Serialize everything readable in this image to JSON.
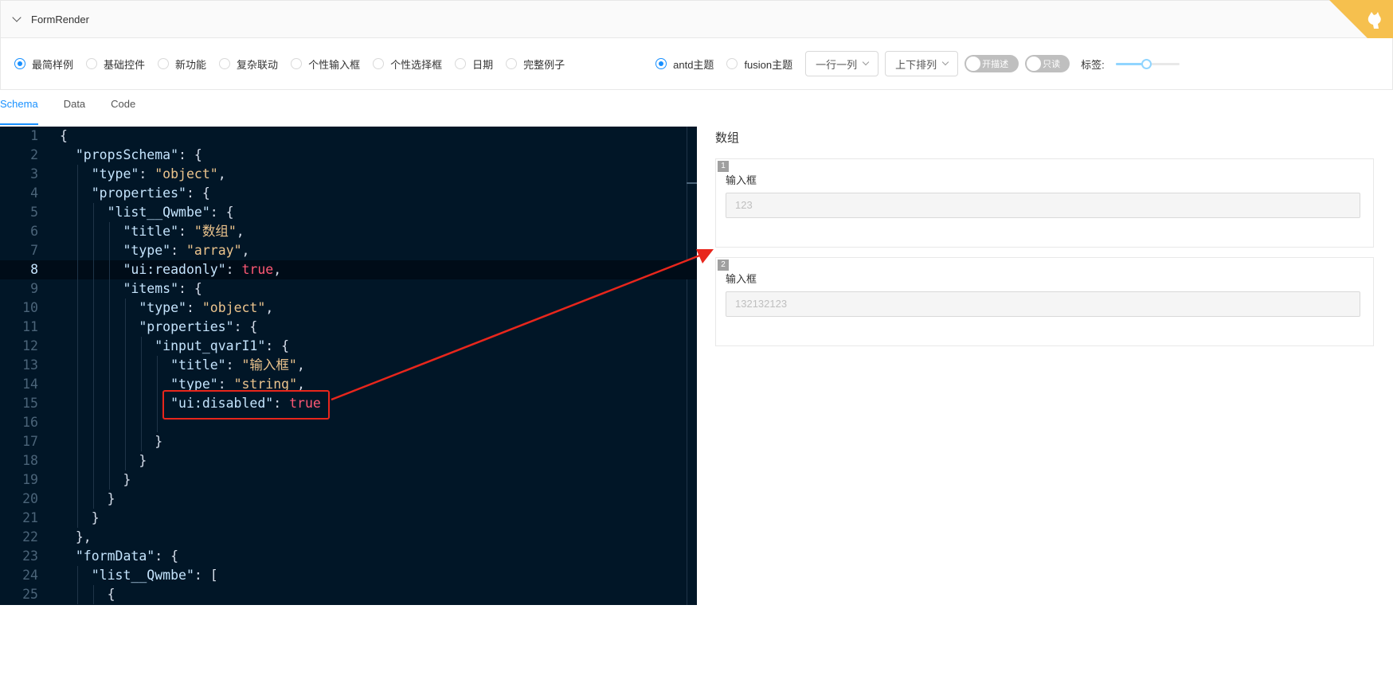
{
  "header": {
    "title": "FormRender"
  },
  "toolbar": {
    "demo_options": [
      {
        "label": "最简样例",
        "checked": true
      },
      {
        "label": "基础控件",
        "checked": false
      },
      {
        "label": "新功能",
        "checked": false
      },
      {
        "label": "复杂联动",
        "checked": false
      },
      {
        "label": "个性输入框",
        "checked": false
      },
      {
        "label": "个性选择框",
        "checked": false
      },
      {
        "label": "日期",
        "checked": false
      },
      {
        "label": "完整例子",
        "checked": false
      }
    ],
    "theme_options": [
      {
        "label": "antd主题",
        "checked": true
      },
      {
        "label": "fusion主题",
        "checked": false
      }
    ],
    "column_select": "一行一列",
    "layout_select": "上下排列",
    "desc_switch": "开描述",
    "readonly_switch": "只读",
    "label_text": "标签:",
    "label_slider_value": 0.48
  },
  "tabs": [
    {
      "label": "Schema",
      "active": true
    },
    {
      "label": "Data",
      "active": false
    },
    {
      "label": "Code",
      "active": false
    }
  ],
  "editor": {
    "current_line": 8,
    "lines": [
      [
        {
          "t": "p",
          "v": "{"
        }
      ],
      [
        {
          "t": "p",
          "v": "  "
        },
        {
          "t": "k",
          "v": "\"propsSchema\""
        },
        {
          "t": "p",
          "v": ": {"
        }
      ],
      [
        {
          "t": "p",
          "v": "    "
        },
        {
          "t": "k",
          "v": "\"type\""
        },
        {
          "t": "p",
          "v": ": "
        },
        {
          "t": "s",
          "v": "\"object\""
        },
        {
          "t": "p",
          "v": ","
        }
      ],
      [
        {
          "t": "p",
          "v": "    "
        },
        {
          "t": "k",
          "v": "\"properties\""
        },
        {
          "t": "p",
          "v": ": {"
        }
      ],
      [
        {
          "t": "p",
          "v": "      "
        },
        {
          "t": "k",
          "v": "\"list__Qwmbe\""
        },
        {
          "t": "p",
          "v": ": {"
        }
      ],
      [
        {
          "t": "p",
          "v": "        "
        },
        {
          "t": "k",
          "v": "\"title\""
        },
        {
          "t": "p",
          "v": ": "
        },
        {
          "t": "s",
          "v": "\"数组\""
        },
        {
          "t": "p",
          "v": ","
        }
      ],
      [
        {
          "t": "p",
          "v": "        "
        },
        {
          "t": "k",
          "v": "\"type\""
        },
        {
          "t": "p",
          "v": ": "
        },
        {
          "t": "s",
          "v": "\"array\""
        },
        {
          "t": "p",
          "v": ","
        }
      ],
      [
        {
          "t": "p",
          "v": "        "
        },
        {
          "t": "k",
          "v": "\"ui:readonly\""
        },
        {
          "t": "p",
          "v": ": "
        },
        {
          "t": "b",
          "v": "true"
        },
        {
          "t": "p",
          "v": ","
        }
      ],
      [
        {
          "t": "p",
          "v": "        "
        },
        {
          "t": "k",
          "v": "\"items\""
        },
        {
          "t": "p",
          "v": ": {"
        }
      ],
      [
        {
          "t": "p",
          "v": "          "
        },
        {
          "t": "k",
          "v": "\"type\""
        },
        {
          "t": "p",
          "v": ": "
        },
        {
          "t": "s",
          "v": "\"object\""
        },
        {
          "t": "p",
          "v": ","
        }
      ],
      [
        {
          "t": "p",
          "v": "          "
        },
        {
          "t": "k",
          "v": "\"properties\""
        },
        {
          "t": "p",
          "v": ": {"
        }
      ],
      [
        {
          "t": "p",
          "v": "            "
        },
        {
          "t": "k",
          "v": "\"input_qvarI1\""
        },
        {
          "t": "p",
          "v": ": {"
        }
      ],
      [
        {
          "t": "p",
          "v": "              "
        },
        {
          "t": "k",
          "v": "\"title\""
        },
        {
          "t": "p",
          "v": ": "
        },
        {
          "t": "s",
          "v": "\"输入框\""
        },
        {
          "t": "p",
          "v": ","
        }
      ],
      [
        {
          "t": "p",
          "v": "              "
        },
        {
          "t": "k",
          "v": "\"type\""
        },
        {
          "t": "p",
          "v": ": "
        },
        {
          "t": "s",
          "v": "\"string\""
        },
        {
          "t": "p",
          "v": ","
        }
      ],
      [
        {
          "t": "p",
          "v": "              "
        },
        {
          "t": "k",
          "v": "\"ui:disabled\""
        },
        {
          "t": "p",
          "v": ": "
        },
        {
          "t": "b",
          "v": "true"
        }
      ],
      [
        {
          "t": "p",
          "v": ""
        }
      ],
      [
        {
          "t": "p",
          "v": "            }"
        }
      ],
      [
        {
          "t": "p",
          "v": "          }"
        }
      ],
      [
        {
          "t": "p",
          "v": "        }"
        }
      ],
      [
        {
          "t": "p",
          "v": "      }"
        }
      ],
      [
        {
          "t": "p",
          "v": "    }"
        }
      ],
      [
        {
          "t": "p",
          "v": "  },"
        }
      ],
      [
        {
          "t": "p",
          "v": "  "
        },
        {
          "t": "k",
          "v": "\"formData\""
        },
        {
          "t": "p",
          "v": ": {"
        }
      ],
      [
        {
          "t": "p",
          "v": "    "
        },
        {
          "t": "k",
          "v": "\"list__Qwmbe\""
        },
        {
          "t": "p",
          "v": ": ["
        }
      ],
      [
        {
          "t": "p",
          "v": "      {"
        }
      ]
    ]
  },
  "preview": {
    "title": "数组",
    "items": [
      {
        "index": "1",
        "label": "输入框",
        "value": "123"
      },
      {
        "index": "2",
        "label": "输入框",
        "value": "132132123"
      }
    ]
  },
  "colors": {
    "accent": "#1890ff",
    "editor_bg": "#011627",
    "annotation_red": "#e8261c",
    "corner": "#f6c04e"
  }
}
